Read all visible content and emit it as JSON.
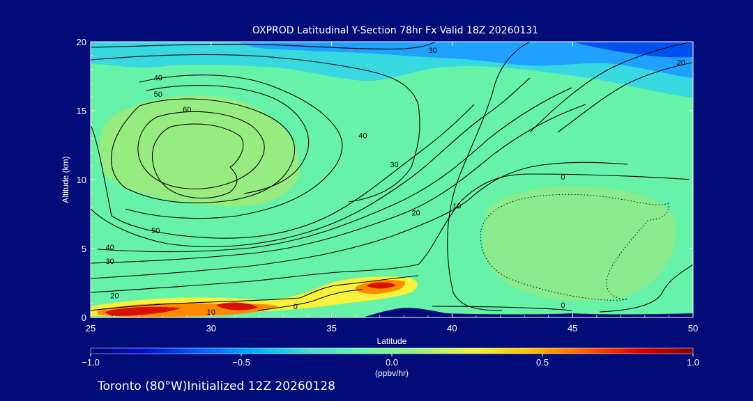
{
  "chart_data": {
    "type": "heatmap",
    "title": "OXPROD Latitudinal Y-Section 78hr  Fx Valid 18Z 20260131",
    "xlabel": "Latitude",
    "ylabel": "Altitude (km)",
    "xlim": [
      25,
      50
    ],
    "ylim": [
      0,
      20
    ],
    "x_ticks": [
      "25",
      "30",
      "35",
      "40",
      "45",
      "50"
    ],
    "y_ticks": [
      "0",
      "5",
      "10",
      "15",
      "20"
    ],
    "colorbar": {
      "min": -1.0,
      "max": 1.0,
      "tick_labels": [
        "-1.0",
        "-0.5",
        "0.0",
        "0.5",
        "1.0"
      ],
      "unit_label": "(ppbv/hr)",
      "colors": [
        "#000070",
        "#0010d0",
        "#0060ff",
        "#00b0ff",
        "#40e0d0",
        "#60ffa8",
        "#a0f080",
        "#f0f040",
        "#ffc000",
        "#ff6000",
        "#e00000",
        "#800000"
      ]
    },
    "filled_regions": [
      {
        "name": "upper-blue",
        "color": "#20a0ff"
      },
      {
        "name": "upper-cyan",
        "color": "#38d8e0"
      },
      {
        "name": "background-green",
        "color": "#66f2a8"
      },
      {
        "name": "high-core",
        "color": "#96ec80"
      },
      {
        "name": "right-core",
        "color": "#8aec8c"
      },
      {
        "name": "surface-yellow",
        "color": "#f6f23a"
      },
      {
        "name": "surface-orange",
        "color": "#ff8a00"
      },
      {
        "name": "surface-red",
        "color": "#d81000"
      },
      {
        "name": "terrain",
        "color": "#020c78"
      }
    ],
    "contour_labels": [
      {
        "text": "30",
        "lat": 39.2,
        "alt": 19.2
      },
      {
        "text": "20",
        "lat": 49.5,
        "alt": 18.3
      },
      {
        "text": "40",
        "lat": 27.8,
        "alt": 17.2
      },
      {
        "text": "50",
        "lat": 27.8,
        "alt": 16.0
      },
      {
        "text": "60",
        "lat": 29.0,
        "alt": 14.9
      },
      {
        "text": "40",
        "lat": 36.3,
        "alt": 13.0
      },
      {
        "text": "30",
        "lat": 37.6,
        "alt": 10.9
      },
      {
        "text": "0",
        "lat": 44.6,
        "alt": 10.0
      },
      {
        "text": "10",
        "lat": 40.2,
        "alt": 7.9
      },
      {
        "text": "20",
        "lat": 38.5,
        "alt": 7.4
      },
      {
        "text": "50",
        "lat": 27.7,
        "alt": 6.1
      },
      {
        "text": "40",
        "lat": 25.8,
        "alt": 4.9
      },
      {
        "text": "30",
        "lat": 25.8,
        "alt": 3.9
      },
      {
        "text": "20",
        "lat": 26.0,
        "alt": 1.4
      },
      {
        "text": "10",
        "lat": 30.0,
        "alt": 0.2
      },
      {
        "text": "0",
        "lat": 33.5,
        "alt": 0.6
      },
      {
        "text": "0",
        "lat": 44.6,
        "alt": 0.7
      }
    ]
  },
  "footer": {
    "location_text": "Toronto (80°W)Initialized 12Z 20260128"
  },
  "colors": {
    "background": "#020c78",
    "axis": "#ffffff",
    "contour": "#000000"
  }
}
